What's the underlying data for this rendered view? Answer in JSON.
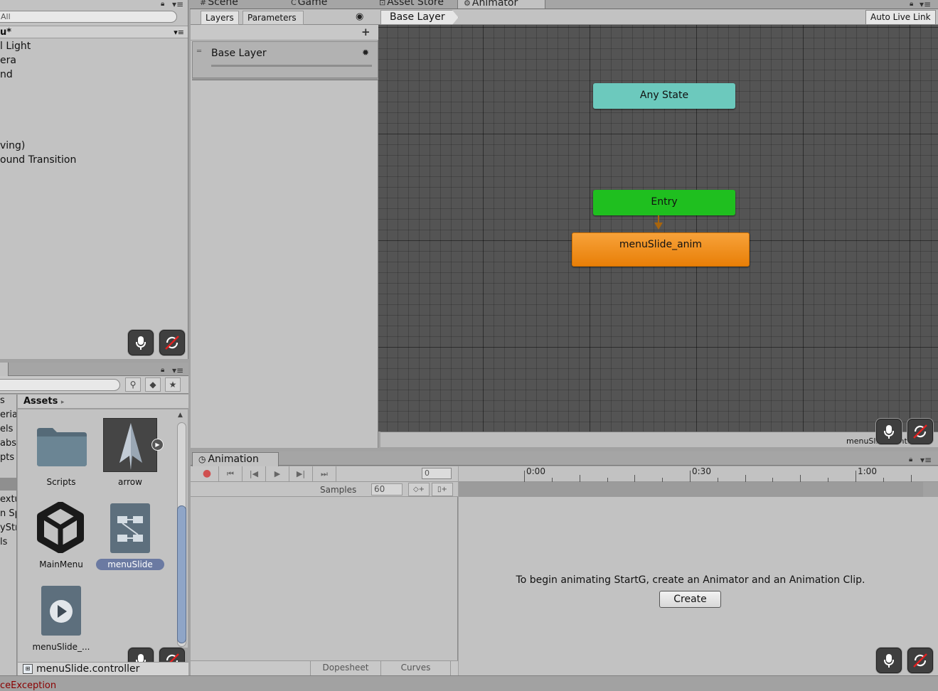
{
  "top_tabs": {
    "scene": "Scene",
    "game": "Game",
    "asset_store": "Asset Store",
    "animator": "Animator"
  },
  "hierarchy": {
    "search_placeholder": "All",
    "scene_name": "u*",
    "items": [
      "l Light",
      "era",
      "nd",
      "ving)",
      "ound Transition"
    ]
  },
  "project": {
    "breadcrumb": "Assets",
    "left_items": [
      "s",
      "eria",
      "els",
      "abs",
      "pts",
      "extu",
      "n Sp",
      "yStr",
      "ls"
    ],
    "assets": [
      {
        "label": "Scripts",
        "icon": "folder-icon"
      },
      {
        "label": "arrow",
        "icon": "arrow-sprite-icon"
      },
      {
        "label": "MainMenu",
        "icon": "unity-logo-icon"
      },
      {
        "label": "menuSlide",
        "icon": "animator-controller-icon",
        "selected": true
      },
      {
        "label": "menuSlide_...",
        "icon": "animation-clip-icon"
      }
    ],
    "footer_file": "menuSlide.controller"
  },
  "animator": {
    "tabs": {
      "layers": "Layers",
      "parameters": "Parameters"
    },
    "layer_name": "Base Layer",
    "breadcrumb": "Base Layer",
    "auto_live_link": "Auto Live Link",
    "nodes": {
      "any_state": "Any State",
      "entry": "Entry",
      "default_state": "menuSlide_anim"
    },
    "footer_file": "menuSlide.controller",
    "colors": {
      "any_state": "#6cc9bd",
      "entry": "#1fbf1f",
      "default_state": "#f08a12"
    }
  },
  "animation": {
    "tab_label": "Animation",
    "frame": "0",
    "samples_label": "Samples",
    "samples_value": "60",
    "timeline_labels": [
      "0:00",
      "0:30",
      "1:00"
    ],
    "message": "To begin animating StartG, create an Animator and an Animation Clip.",
    "create_label": "Create",
    "footer_tabs": {
      "dopesheet": "Dopesheet",
      "curves": "Curves"
    }
  },
  "status": {
    "text": "ceException"
  }
}
